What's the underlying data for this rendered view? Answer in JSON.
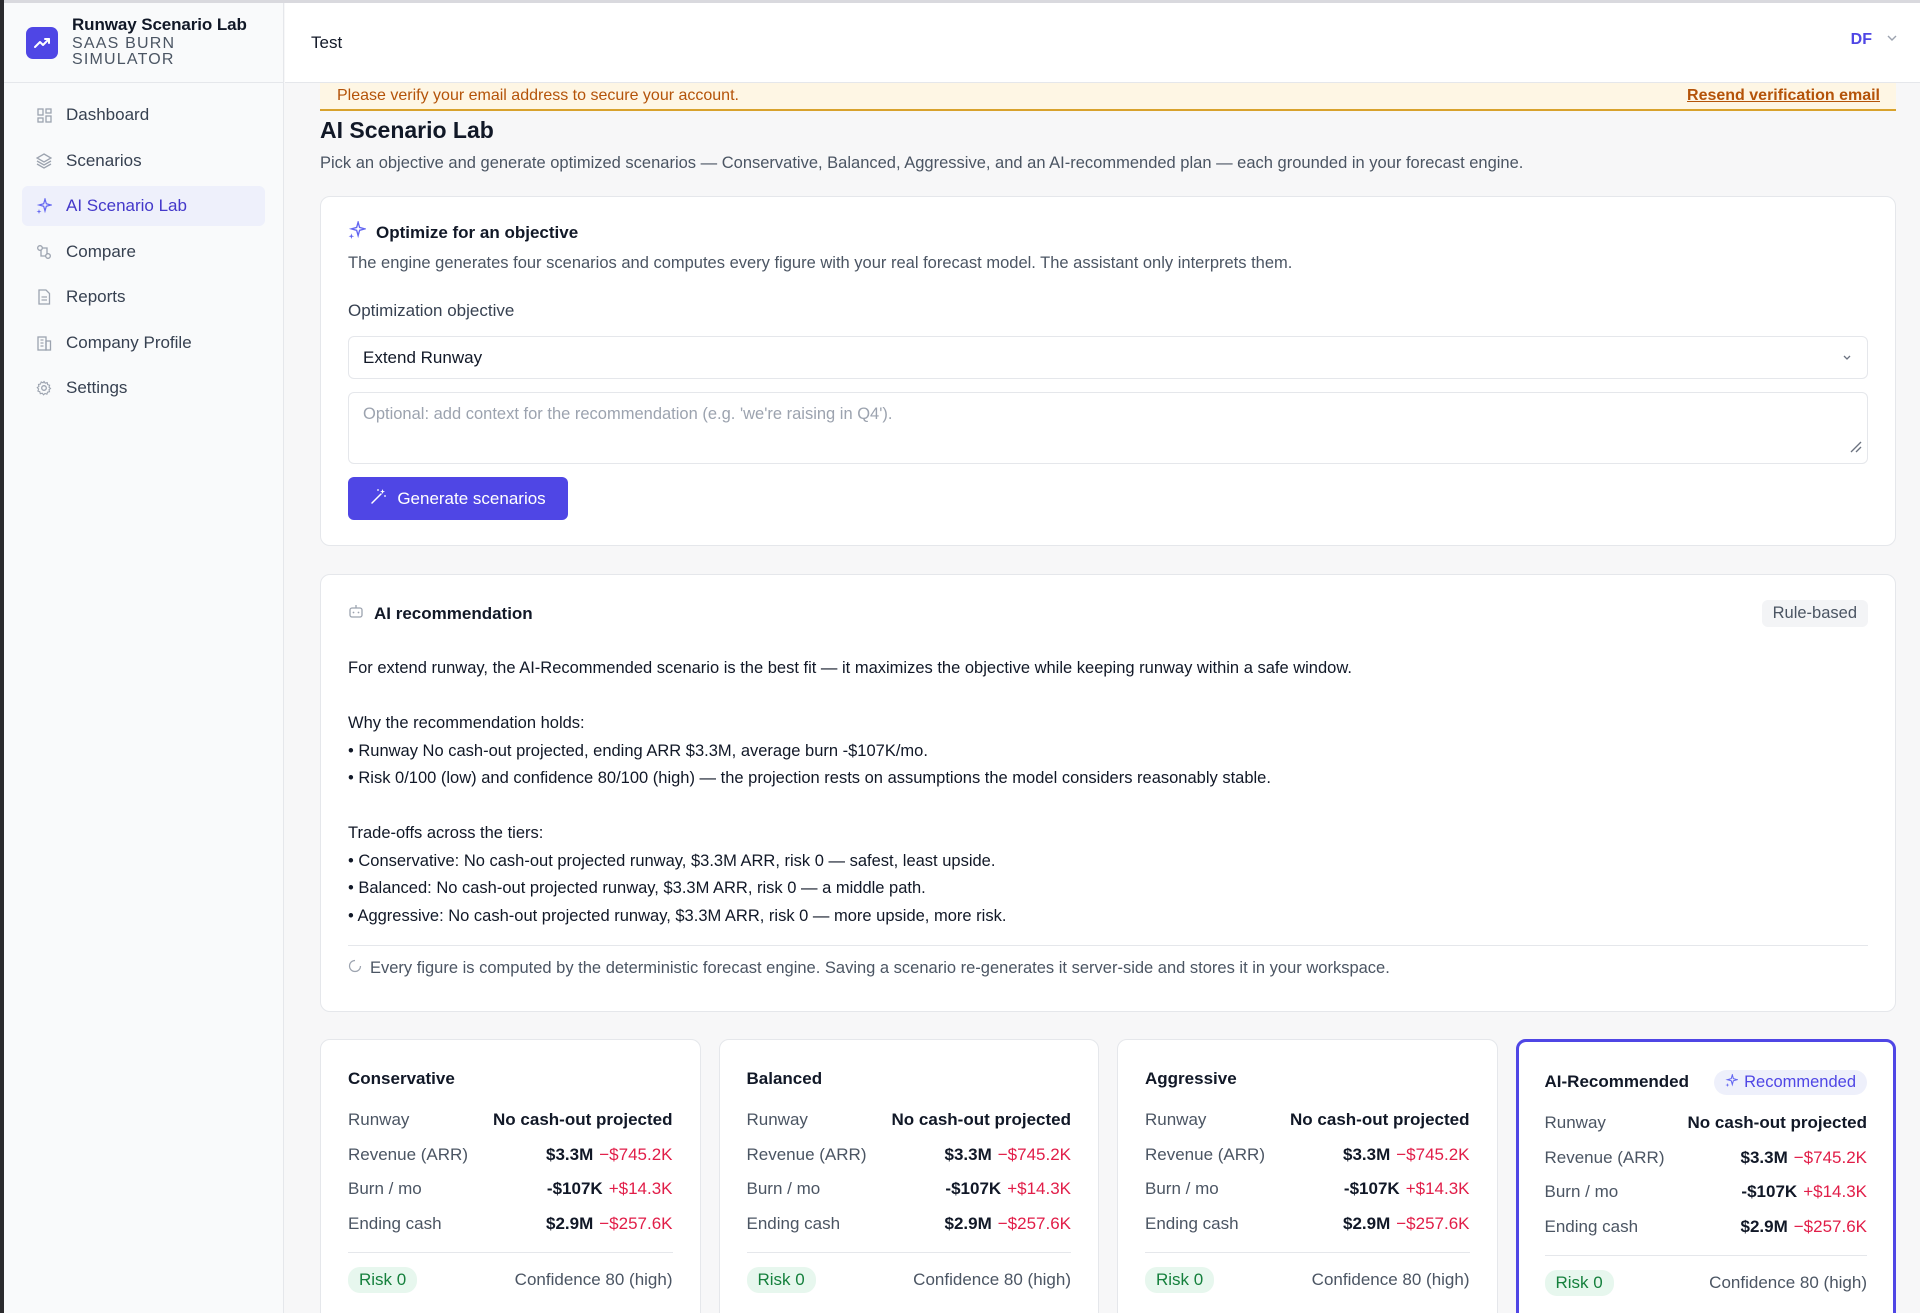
{
  "brand": {
    "name": "Runway Scenario Lab",
    "sub_line1": "SAAS BURN",
    "sub_line2": "SIMULATOR"
  },
  "sidebar": {
    "items": [
      {
        "label": "Dashboard",
        "icon": "dashboard-icon",
        "active": false
      },
      {
        "label": "Scenarios",
        "icon": "layers-icon",
        "active": false
      },
      {
        "label": "AI Scenario Lab",
        "icon": "sparkles-icon",
        "active": true
      },
      {
        "label": "Compare",
        "icon": "compare-icon",
        "active": false
      },
      {
        "label": "Reports",
        "icon": "file-icon",
        "active": false
      },
      {
        "label": "Company Profile",
        "icon": "building-icon",
        "active": false
      },
      {
        "label": "Settings",
        "icon": "gear-icon",
        "active": false
      }
    ]
  },
  "header": {
    "title": "Test",
    "user_initials": "DF"
  },
  "banner": {
    "text": "Please verify your email address to secure your account.",
    "link": "Resend verification email"
  },
  "page": {
    "title": "AI Scenario Lab",
    "description": "Pick an objective and generate optimized scenarios — Conservative, Balanced, Aggressive, and an AI-recommended plan — each grounded in your forecast engine."
  },
  "objective_card": {
    "title": "Optimize for an objective",
    "subtitle": "The engine generates four scenarios and computes every figure with your real forecast model. The assistant only interprets them.",
    "field_label": "Optimization objective",
    "selected_objective": "Extend Runway",
    "context_placeholder": "Optional: add context for the recommendation (e.g. 'we're raising in Q4').",
    "generate_label": "Generate scenarios"
  },
  "recommendation_card": {
    "title": "AI recommendation",
    "badge": "Rule-based",
    "lines": [
      "For extend runway, the AI-Recommended scenario is the best fit — it maximizes the objective while keeping runway within a safe window.",
      "",
      "Why the recommendation holds:",
      "• Runway No cash-out projected, ending ARR $3.3M, average burn -$107K/mo.",
      "• Risk 0/100 (low) and confidence 80/100 (high) — the projection rests on assumptions the model considers reasonably stable.",
      "",
      "Trade-offs across the tiers:",
      "• Conservative: No cash-out projected runway, $3.3M ARR, risk 0 — safest, least upside.",
      "• Balanced: No cash-out projected runway, $3.3M ARR, risk 0 — a middle path.",
      "• Aggressive: No cash-out projected runway, $3.3M ARR, risk 0 — more upside, more risk."
    ],
    "footnote": "Every figure is computed by the deterministic forecast engine. Saving a scenario re-generates it server-side and stores it in your workspace."
  },
  "tiers": [
    {
      "name": "Conservative",
      "recommended_badge": "",
      "runway_label": "Runway",
      "runway": "No cash-out projected",
      "arr_label": "Revenue (ARR)",
      "arr": "$3.3M",
      "arr_delta": "−$745.2K",
      "burn_label": "Burn / mo",
      "burn": "-$107K",
      "burn_delta": "+$14.3K",
      "cash_label": "Ending cash",
      "cash": "$2.9M",
      "cash_delta": "−$257.6K",
      "risk": "Risk 0",
      "confidence": "Confidence 80 (high)"
    },
    {
      "name": "Balanced",
      "recommended_badge": "",
      "runway_label": "Runway",
      "runway": "No cash-out projected",
      "arr_label": "Revenue (ARR)",
      "arr": "$3.3M",
      "arr_delta": "−$745.2K",
      "burn_label": "Burn / mo",
      "burn": "-$107K",
      "burn_delta": "+$14.3K",
      "cash_label": "Ending cash",
      "cash": "$2.9M",
      "cash_delta": "−$257.6K",
      "risk": "Risk 0",
      "confidence": "Confidence 80 (high)"
    },
    {
      "name": "Aggressive",
      "recommended_badge": "",
      "runway_label": "Runway",
      "runway": "No cash-out projected",
      "arr_label": "Revenue (ARR)",
      "arr": "$3.3M",
      "arr_delta": "−$745.2K",
      "burn_label": "Burn / mo",
      "burn": "-$107K",
      "burn_delta": "+$14.3K",
      "cash_label": "Ending cash",
      "cash": "$2.9M",
      "cash_delta": "−$257.6K",
      "risk": "Risk 0",
      "confidence": "Confidence 80 (high)"
    },
    {
      "name": "AI-Recommended",
      "recommended_badge": "Recommended",
      "runway_label": "Runway",
      "runway": "No cash-out projected",
      "arr_label": "Revenue (ARR)",
      "arr": "$3.3M",
      "arr_delta": "−$745.2K",
      "burn_label": "Burn / mo",
      "burn": "-$107K",
      "burn_delta": "+$14.3K",
      "cash_label": "Ending cash",
      "cash": "$2.9M",
      "cash_delta": "−$257.6K",
      "risk": "Risk 0",
      "confidence": "Confidence 80 (high)"
    }
  ],
  "colors": {
    "accent": "#4f46e5",
    "warning": "#b45309",
    "negative": "#e11d48",
    "positive": "#15803d"
  }
}
